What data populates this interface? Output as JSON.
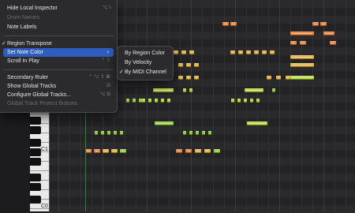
{
  "menu": {
    "items": [
      {
        "label": "Hide Local Inspector",
        "shortcut": "⌥ I",
        "disabled": false
      },
      {
        "label": "Drum Names",
        "shortcut": "",
        "disabled": true
      },
      {
        "label": "Note Labels",
        "shortcut": "",
        "disabled": false
      },
      {
        "label": "Region Transpose",
        "shortcut": "",
        "checked": true,
        "disabled": false
      },
      {
        "label": "Set Note Color",
        "shortcut": "",
        "submenu": true,
        "highlighted": true
      },
      {
        "label": "Scroll In Play",
        "shortcut": "⌃ ⇧",
        "disabled": false
      },
      {
        "label": "Secondary Ruler",
        "shortcut": "⌃ ⌥ ⇧ ⌘",
        "disabled": false
      },
      {
        "label": "Show Global Tracks",
        "shortcut": "G",
        "disabled": false
      },
      {
        "label": "Configure Global Tracks...",
        "shortcut": "⌥ G",
        "disabled": false
      },
      {
        "label": "Global Track Protect Buttons",
        "shortcut": "",
        "disabled": true
      }
    ],
    "check_glyph": "✓",
    "arrow_glyph": "›"
  },
  "submenu": {
    "items": [
      {
        "label": "By Region Color",
        "checked": false
      },
      {
        "label": "By Velocity",
        "checked": false
      },
      {
        "label": "By MIDI Channel",
        "checked": true
      }
    ]
  },
  "keyboard": {
    "labels": [
      "C1",
      "C0"
    ]
  },
  "colors": {
    "note_orange": "#e7813a",
    "note_yellow": "#e3b23c",
    "note_green": "#8fd03a",
    "note_lime": "#b6d83a",
    "playhead": "#1f8a3a",
    "menu_highlight": "#2f5dbf"
  }
}
